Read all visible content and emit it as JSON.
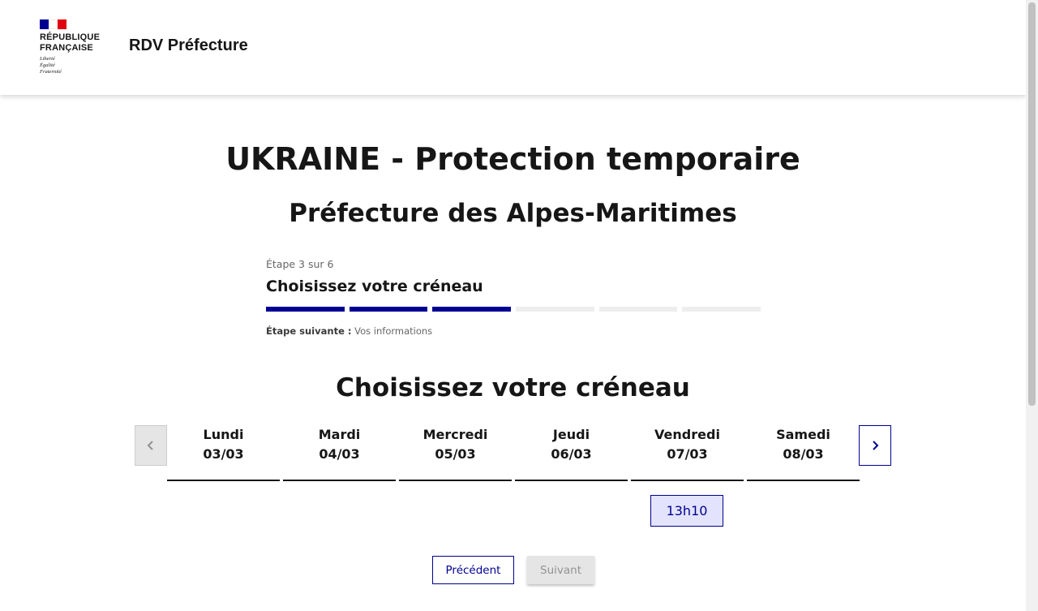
{
  "header": {
    "republic_name": "RÉPUBLIQUE\nFRANÇAISE",
    "motto": "Liberté\nÉgalité\nFraternité",
    "service_title": "RDV Préfecture"
  },
  "page": {
    "title": "UKRAINE - Protection temporaire",
    "subtitle": "Préfecture des Alpes-Maritimes"
  },
  "stepper": {
    "step_count": "Étape 3 sur 6",
    "step_title": "Choisissez votre créneau",
    "steps_total": 6,
    "steps_done": 3,
    "next_label": "Étape suivante :",
    "next_value": "Vos informations"
  },
  "calendar": {
    "title": "Choisissez votre créneau",
    "prev_icon": "chevron-left-icon",
    "next_icon": "chevron-right-icon",
    "days": [
      {
        "name": "Lundi",
        "date": "03/03"
      },
      {
        "name": "Mardi",
        "date": "04/03"
      },
      {
        "name": "Mercredi",
        "date": "05/03"
      },
      {
        "name": "Jeudi",
        "date": "06/03"
      },
      {
        "name": "Vendredi",
        "date": "07/03"
      },
      {
        "name": "Samedi",
        "date": "08/03"
      }
    ],
    "slot": "13h10"
  },
  "buttons": {
    "previous": "Précédent",
    "next": "Suivant"
  },
  "colors": {
    "primary": "#000091",
    "flag_red": "#e1000f",
    "slot_bg": "#e3e3fd"
  }
}
